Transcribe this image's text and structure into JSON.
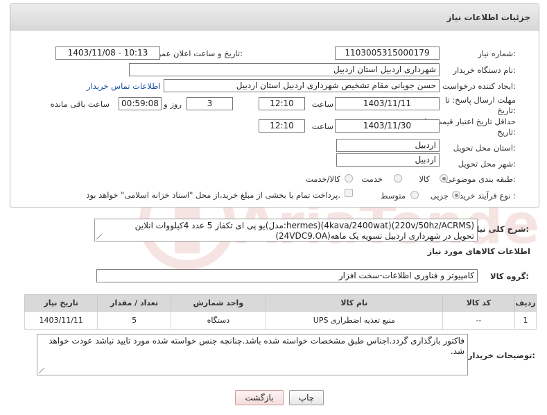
{
  "panel": {
    "title": "جزئیات اطلاعات نیاز"
  },
  "fields": {
    "need_number_label": "شماره نیاز:",
    "need_number": "1103005315000179",
    "announce_label": "تاریخ و ساعت اعلان عمومی:",
    "announce_value": "1403/11/08 - 10:13",
    "buyer_label": "نام دستگاه خریدار:",
    "buyer_value": "شهرداری اردبیل استان اردبیل",
    "creator_label": "ایجاد کننده درخواست:",
    "creator_value": "حسن جویانی مقام تشخیص شهرداری اردبیل استان اردبیل",
    "contact_link": "اطلاعات تماس خریدار",
    "deadline_label_1": "مهلت ارسال پاسخ: تا",
    "deadline_label_2": "تاریخ:",
    "deadline_date": "1403/11/11",
    "time_label": "ساعت",
    "deadline_time": "12:10",
    "days_value": "3",
    "days_label": "روز و",
    "remaining_time": "00:59:08",
    "remaining_label": "ساعت باقی مانده",
    "validity_label_1": "حداقل تاریخ اعتبار قیمت: تا",
    "validity_label_2": "تاریخ:",
    "validity_date": "1403/11/30",
    "validity_time_label": "ساعت",
    "validity_time": "12:10",
    "province_label": "استان محل تحویل:",
    "province_value": "اردبیل",
    "city_label": "شهر محل تحویل:",
    "city_value": "اردبیل",
    "category_label": "طبقه بندی موضوعی:",
    "category_options": [
      "کالا",
      "خدمت",
      "کالا/خدمت"
    ],
    "purchase_label": "نوع فرآیند خرید :",
    "purchase_options": [
      "جزیی",
      "متوسط"
    ],
    "payment_note": "پرداخت تمام یا بخشی از مبلغ خرید،از محل \"اسناد خزانه اسلامی\" خواهد بود."
  },
  "description": {
    "label": "شرح کلی نیاز:",
    "line1": "یو پی ای تکفاز 5 عدد 4کیلووات انلاین(مدل:hermes)(4kava/2400wat)(220v/50hz/ACRMS)",
    "line2": "(24VDC9.OA)تحویل در شهرداری اردبیل تسویه یک ماهه"
  },
  "goods": {
    "section_title": "اطلاعات کالاهای مورد نیاز",
    "group_label": "گروه کالا:",
    "group_value": "کامپیوتر و فناوری اطلاعات-سخت افزار",
    "headers": [
      "ردیف",
      "کد کالا",
      "نام کالا",
      "واحد شمارش",
      "تعداد / مقدار",
      "تاریخ نیاز"
    ],
    "rows": [
      {
        "row": "1",
        "code": "--",
        "name": "منبع تغذیه اضطراری UPS",
        "unit": "دستگاه",
        "qty": "5",
        "date": "1403/11/11"
      }
    ]
  },
  "buyer_notes": {
    "label": "توضیحات خریدار:",
    "text": "فاکتور بارگذاری گردد.اجناس طبق مشخصات خواسته شده باشد.چنانچه جنس خواسته شده مورد تایید نباشد عودت خواهد شد."
  },
  "buttons": {
    "print": "چاپ",
    "back": "بازگشت"
  },
  "watermark": {
    "text": "AriaTender.neT"
  }
}
